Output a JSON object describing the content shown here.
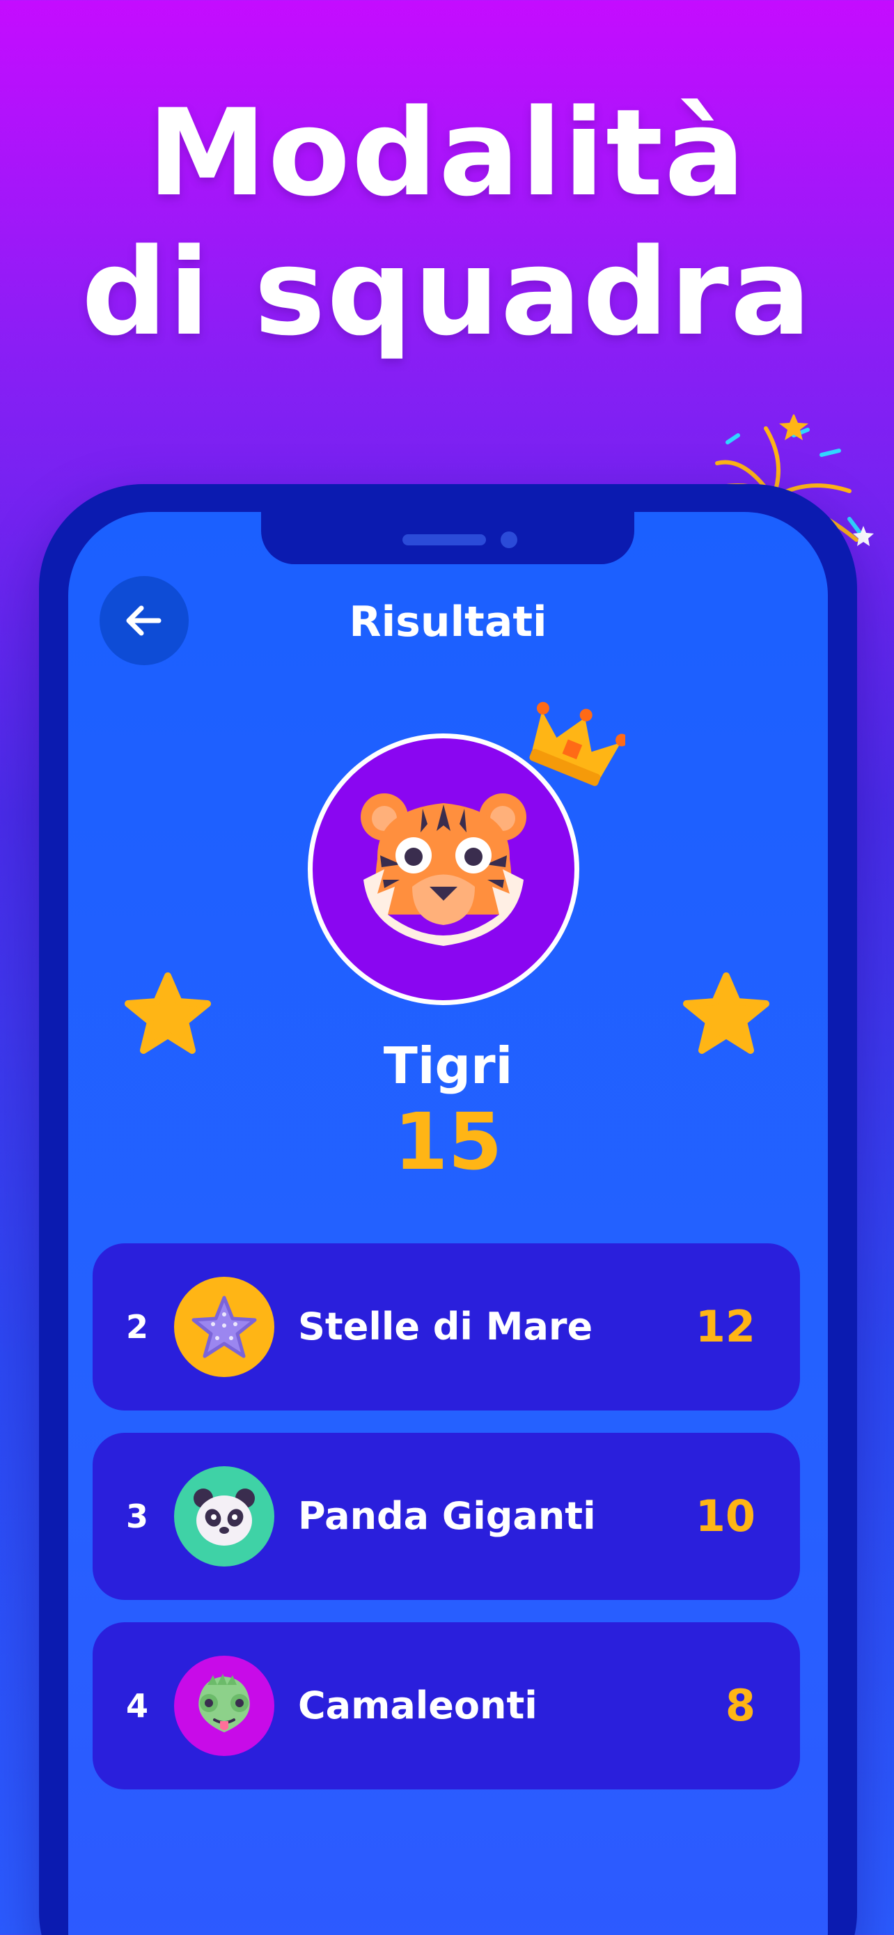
{
  "headline": {
    "line1": "Modalità",
    "line2": "di squadra"
  },
  "screen": {
    "title": "Risultati",
    "back_icon": "arrow-left-icon"
  },
  "winner": {
    "name": "Tigri",
    "score": "15",
    "avatar_icon": "tiger-icon",
    "crown_icon": "crown-icon"
  },
  "ranking": [
    {
      "rank": "2",
      "name": "Stelle di Mare",
      "score": "12",
      "avatar_icon": "starfish-icon",
      "avatar_color": "#ffb515"
    },
    {
      "rank": "3",
      "name": "Panda Giganti",
      "score": "10",
      "avatar_icon": "panda-icon",
      "avatar_color": "#3fd2a6"
    },
    {
      "rank": "4",
      "name": "Camaleonti",
      "score": "8",
      "avatar_icon": "chameleon-icon",
      "avatar_color": "#c80be8"
    }
  ],
  "colors": {
    "accent_gold": "#ffb515",
    "row_background": "#2a1fdc",
    "screen_background": "#1b60ff",
    "winner_circle": "#8a06f1"
  }
}
